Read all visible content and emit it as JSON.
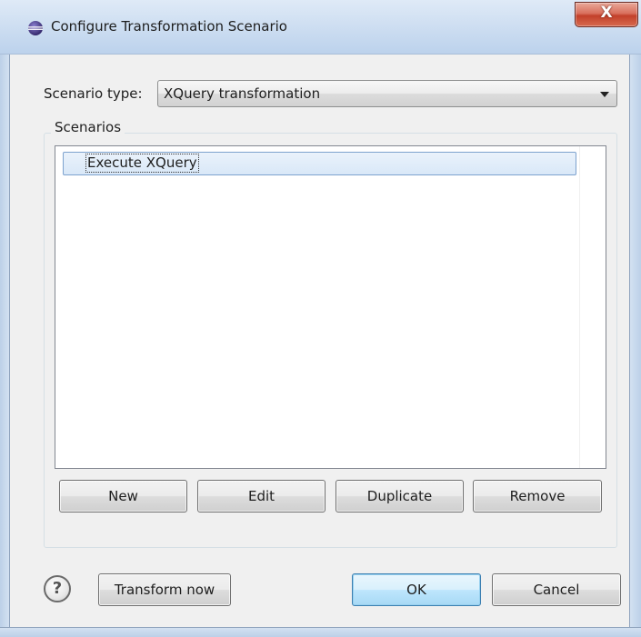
{
  "window": {
    "title": "Configure Transformation Scenario",
    "close_glyph": "X"
  },
  "scenario_type": {
    "label": "Scenario type:",
    "value": "XQuery transformation"
  },
  "scenarios": {
    "group_label": "Scenarios",
    "items": [
      "Execute XQuery"
    ],
    "selected_index": 0
  },
  "scenario_buttons": {
    "new": "New",
    "edit": "Edit",
    "duplicate": "Duplicate",
    "remove": "Remove"
  },
  "footer": {
    "help_glyph": "?",
    "transform_now": "Transform now",
    "ok": "OK",
    "cancel": "Cancel"
  },
  "icons": {
    "app": "eclipse-icon",
    "help": "help-icon",
    "close": "close-icon",
    "dropdown": "chevron-down-icon"
  },
  "colors": {
    "selection_fill": "#d9e8f8",
    "selection_border": "#7da2ce",
    "close_button": "#c2402a",
    "default_button": "#bee6fd"
  }
}
